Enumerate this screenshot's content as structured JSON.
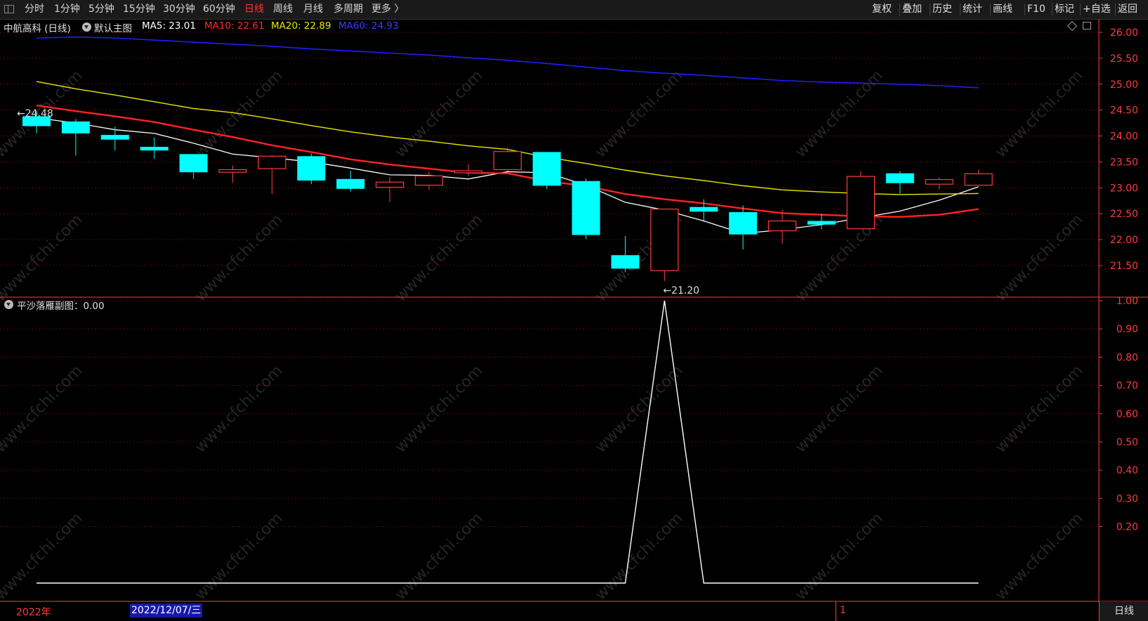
{
  "toolbar": {
    "periods": [
      "分时",
      "1分钟",
      "5分钟",
      "15分钟",
      "30分钟",
      "60分钟",
      "日线",
      "周线",
      "月线",
      "多周期",
      "更多 〉"
    ],
    "active_period": "日线",
    "right_buttons": [
      "复权",
      "叠加",
      "历史",
      "统计",
      "画线",
      "F10",
      "标记",
      "+自选",
      "返回"
    ]
  },
  "main_legend": {
    "stock": "中航高科 (日线)",
    "template": "默认主图",
    "ma5": "MA5: 23.01",
    "ma10": "MA10: 22.61",
    "ma20": "MA20: 22.89",
    "ma60": "MA60: 24.93"
  },
  "sub_legend": {
    "label": "平沙落雁副图：0.00"
  },
  "annotations": {
    "high": "24.48",
    "low": "21.20"
  },
  "date_bar": {
    "year": "2022年",
    "cursor_date": "2022/12/07/三",
    "month_marker": "1",
    "period_label": "日线"
  },
  "watermark": "www.cfchi.com",
  "colors": {
    "up": "#ff3b3b",
    "down": "#00ffff",
    "ma5": "#ffffff",
    "ma10": "#ff2222",
    "ma20": "#e8e800",
    "ma60": "#1e1eff",
    "axis": "#ff3b3b"
  },
  "chart_data": [
    {
      "type": "candlestick",
      "title": "中航高科 (日线)",
      "ylim": [
        21.1,
        26.1
      ],
      "y_ticks": [
        "26.00",
        "25.50",
        "25.00",
        "24.50",
        "24.00",
        "23.50",
        "23.00",
        "22.50",
        "22.00",
        "21.50"
      ],
      "candles": [
        {
          "open": 24.19,
          "close": 24.38,
          "high": 24.48,
          "low": 24.05,
          "dir": "down"
        },
        {
          "open": 24.05,
          "close": 24.28,
          "high": 24.33,
          "low": 23.62,
          "dir": "down"
        },
        {
          "open": 23.93,
          "close": 24.02,
          "high": 24.18,
          "low": 23.72,
          "dir": "down"
        },
        {
          "open": 23.72,
          "close": 23.79,
          "high": 23.97,
          "low": 23.56,
          "dir": "down"
        },
        {
          "open": 23.3,
          "close": 23.65,
          "high": 23.65,
          "low": 23.17,
          "dir": "down"
        },
        {
          "open": 23.3,
          "close": 23.35,
          "high": 23.43,
          "low": 23.1,
          "dir": "up"
        },
        {
          "open": 23.37,
          "close": 23.61,
          "high": 23.63,
          "low": 22.88,
          "dir": "up"
        },
        {
          "open": 23.14,
          "close": 23.61,
          "high": 23.66,
          "low": 23.07,
          "dir": "down"
        },
        {
          "open": 22.98,
          "close": 23.17,
          "high": 23.33,
          "low": 22.93,
          "dir": "down"
        },
        {
          "open": 23.01,
          "close": 23.11,
          "high": 23.21,
          "low": 22.72,
          "dir": "up"
        },
        {
          "open": 23.05,
          "close": 23.23,
          "high": 23.31,
          "low": 22.96,
          "dir": "up"
        },
        {
          "open": 23.29,
          "close": 23.33,
          "high": 23.46,
          "low": 23.22,
          "dir": "up"
        },
        {
          "open": 23.35,
          "close": 23.7,
          "high": 23.78,
          "low": 23.32,
          "dir": "up"
        },
        {
          "open": 23.04,
          "close": 23.69,
          "high": 23.69,
          "low": 22.98,
          "dir": "down"
        },
        {
          "open": 22.09,
          "close": 23.13,
          "high": 23.18,
          "low": 22.01,
          "dir": "down"
        },
        {
          "open": 21.44,
          "close": 21.7,
          "high": 22.07,
          "low": 21.37,
          "dir": "down"
        },
        {
          "open": 21.4,
          "close": 22.59,
          "high": 22.59,
          "low": 21.2,
          "dir": "up"
        },
        {
          "open": 22.54,
          "close": 22.63,
          "high": 22.78,
          "low": 22.34,
          "dir": "down"
        },
        {
          "open": 22.1,
          "close": 22.53,
          "high": 22.66,
          "low": 21.81,
          "dir": "down"
        },
        {
          "open": 22.17,
          "close": 22.36,
          "high": 22.58,
          "low": 21.92,
          "dir": "up"
        },
        {
          "open": 22.29,
          "close": 22.36,
          "high": 22.5,
          "low": 22.2,
          "dir": "down"
        },
        {
          "open": 22.21,
          "close": 23.22,
          "high": 23.32,
          "low": 22.21,
          "dir": "up"
        },
        {
          "open": 23.09,
          "close": 23.28,
          "high": 23.32,
          "low": 22.89,
          "dir": "down"
        },
        {
          "open": 23.07,
          "close": 23.16,
          "high": 23.2,
          "low": 22.97,
          "dir": "up"
        },
        {
          "open": 23.05,
          "close": 23.27,
          "high": 23.35,
          "low": 23.05,
          "dir": "up"
        }
      ],
      "series": [
        {
          "name": "MA5",
          "values": [
            24.35,
            24.25,
            24.12,
            24.05,
            23.86,
            23.65,
            23.58,
            23.5,
            23.38,
            23.25,
            23.24,
            23.17,
            23.31,
            23.29,
            23.05,
            22.72,
            22.57,
            22.36,
            22.12,
            22.19,
            22.29,
            22.42,
            22.55,
            22.76,
            23.02
          ]
        },
        {
          "name": "MA10",
          "values": [
            24.59,
            24.48,
            24.38,
            24.27,
            24.12,
            23.98,
            23.82,
            23.69,
            23.55,
            23.45,
            23.37,
            23.29,
            23.28,
            23.13,
            23.03,
            22.88,
            22.78,
            22.7,
            22.6,
            22.51,
            22.48,
            22.45,
            22.44,
            22.48,
            22.59
          ]
        },
        {
          "name": "MA20",
          "values": [
            25.05,
            24.91,
            24.79,
            24.66,
            24.53,
            24.45,
            24.33,
            24.2,
            24.08,
            23.98,
            23.9,
            23.81,
            23.74,
            23.59,
            23.47,
            23.34,
            23.23,
            23.14,
            23.04,
            22.96,
            22.92,
            22.89,
            22.87,
            22.88,
            22.89
          ]
        },
        {
          "name": "MA60",
          "values": [
            25.89,
            25.91,
            25.89,
            25.85,
            25.81,
            25.77,
            25.73,
            25.68,
            25.64,
            25.6,
            25.56,
            25.51,
            25.46,
            25.4,
            25.33,
            25.26,
            25.21,
            25.17,
            25.12,
            25.07,
            25.04,
            25.02,
            25.0,
            24.97,
            24.93
          ]
        }
      ]
    },
    {
      "type": "line",
      "title": "平沙落雁副图：0.00",
      "ylim": [
        0,
        1.0
      ],
      "y_ticks": [
        "1.00",
        "0.90",
        "0.80",
        "0.70",
        "0.60",
        "0.50",
        "0.40",
        "0.30",
        "0.20"
      ],
      "series": [
        {
          "name": "平沙落雁副图",
          "values": [
            0,
            0,
            0,
            0,
            0,
            0,
            0,
            0,
            0,
            0,
            0,
            0,
            0,
            0,
            0,
            0,
            1,
            0,
            0,
            0,
            0,
            0,
            0,
            0,
            0
          ]
        }
      ]
    }
  ]
}
